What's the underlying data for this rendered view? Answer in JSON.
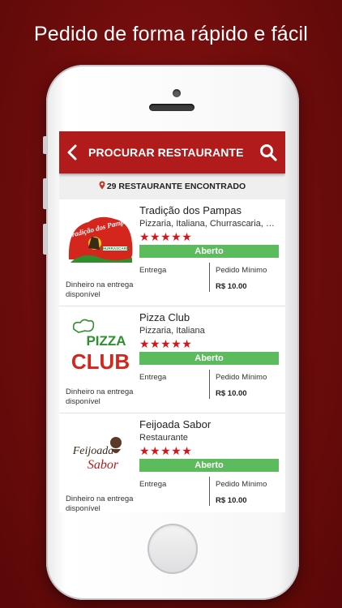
{
  "tagline": "Pedido de forma rápido e fácil",
  "header": {
    "title": "PROCURAR RESTAURANTE"
  },
  "result_count": "29 RESTAURANTE ENCONTRADO",
  "colors": {
    "brand_red": "#b21b1b",
    "status_green": "#5cbb5c",
    "star_red": "#d7141a",
    "background": "#6e0c0c"
  },
  "restaurants": [
    {
      "name": "Tradição dos Pampas",
      "categories": "Pizzaria, Italiana, Churrascaria, Re...",
      "rating": 5,
      "stars": "★★★★★",
      "status": "Aberto",
      "delivery_label": "Entrega",
      "min_order_label": "Pedido Mínimo",
      "min_order_value": "R$ 10.00",
      "payment_note": "Dinheiro na entrega disponível",
      "logo_text": "Tradição dos Pampas",
      "logo_sub": "CHURRASCARIA"
    },
    {
      "name": "Pizza Club",
      "categories": "Pizzaria, Italiana",
      "rating": 5,
      "stars": "★★★★★",
      "status": "Aberto",
      "delivery_label": "Entrega",
      "min_order_label": "Pedido Mínimo",
      "min_order_value": "R$ 10.00",
      "payment_note": "Dinheiro na entrega disponível",
      "logo_top": "PIZZA",
      "logo_bottom": "CLUB"
    },
    {
      "name": "Feijoada Sabor",
      "categories": "Restaurante",
      "rating": 5,
      "stars": "★★★★★",
      "status": "Aberto",
      "delivery_label": "Entrega",
      "min_order_label": "Pedido Mínimo",
      "min_order_value": "R$ 10.00",
      "payment_note": "Dinheiro na entrega disponível",
      "logo_top": "Feijoada",
      "logo_bottom": "Sabor"
    }
  ]
}
